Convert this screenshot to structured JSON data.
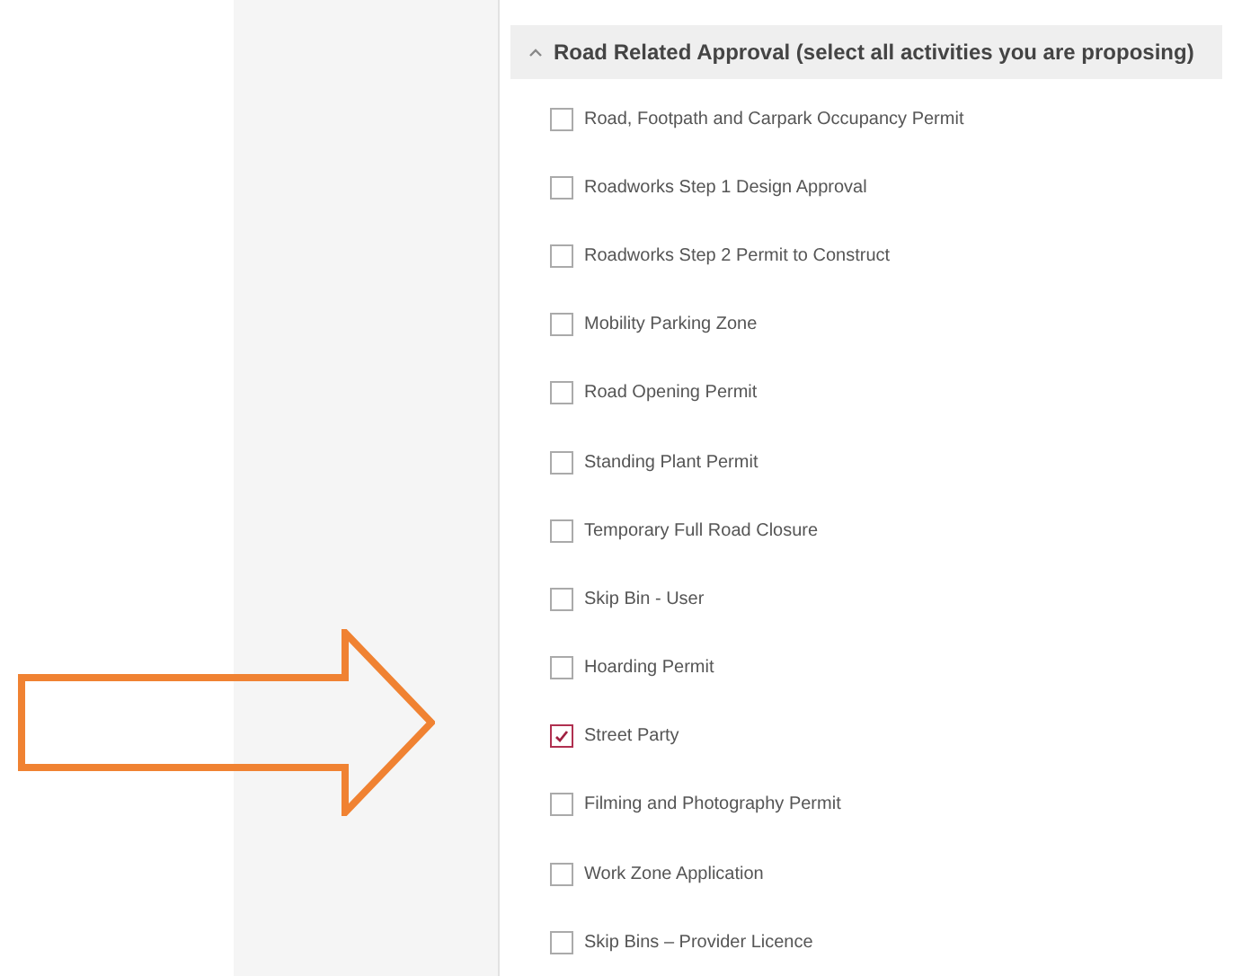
{
  "section": {
    "title": "Road Related Approval (select all activities you are proposing)",
    "expanded": true
  },
  "options": [
    {
      "label": "Road, Footpath and Carpark Occupancy Permit",
      "checked": false
    },
    {
      "label": "Roadworks Step 1 Design Approval",
      "checked": false
    },
    {
      "label": "Roadworks Step 2 Permit to Construct",
      "checked": false
    },
    {
      "label": "Mobility Parking Zone",
      "checked": false
    },
    {
      "label": "Road Opening Permit",
      "checked": false
    },
    {
      "label": "Standing Plant Permit",
      "checked": false
    },
    {
      "label": "Temporary Full Road Closure",
      "checked": false
    },
    {
      "label": "Skip Bin - User",
      "checked": false
    },
    {
      "label": "Hoarding Permit",
      "checked": false
    },
    {
      "label": "Street Party",
      "checked": true
    },
    {
      "label": "Filming and Photography Permit",
      "checked": false
    },
    {
      "label": "Work Zone Application",
      "checked": false
    },
    {
      "label": "Skip Bins – Provider Licence",
      "checked": false
    }
  ]
}
